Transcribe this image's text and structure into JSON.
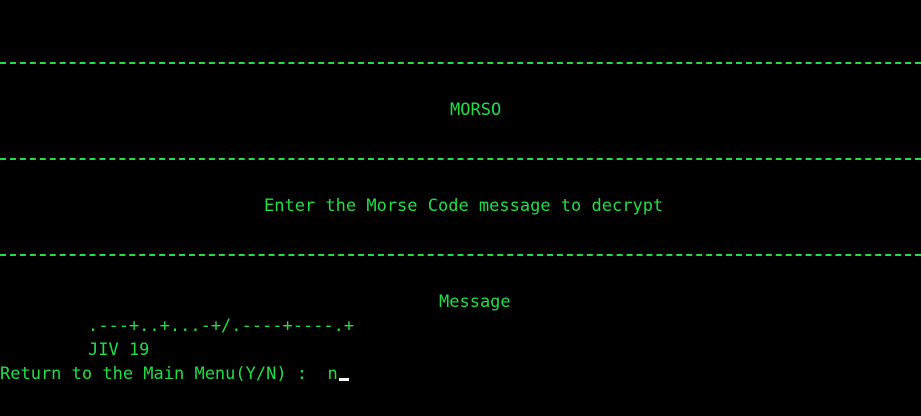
{
  "terminal": {
    "colors": {
      "background": "#000000",
      "foreground": "#22dd44",
      "cursor": "#ffffff"
    },
    "title": "MORSO",
    "instruction": "Enter the Morse Code message to decrypt",
    "message_header": "Message",
    "morse_input": ".---+..+...-+/.----+----.+",
    "decoded_output": "JIV 19",
    "return_prompt": "Return to the Main Menu(Y/N) :  ",
    "return_value": "n"
  }
}
